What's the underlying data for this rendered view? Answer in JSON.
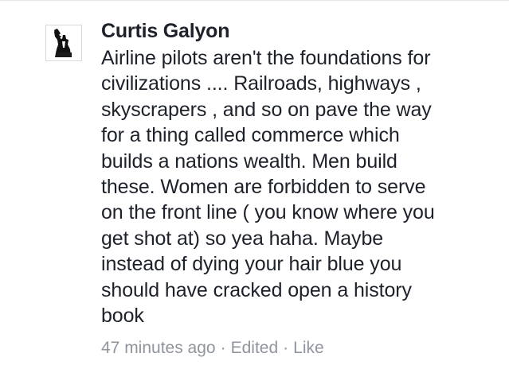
{
  "comment": {
    "author_name": "Curtis Galyon",
    "body_lines": [
      "Airline pilots aren't the foundations for",
      "civilizations .... Railroads, highways ,",
      "skyscrapers , and so on pave the way",
      "for a thing called commerce which",
      "builds a nations wealth. Men build",
      "these. Women are forbidden to serve",
      "on the front line ( you know where you",
      "get shot at) so yea haha. Maybe",
      "instead of dying your hair blue you",
      "should have cracked open a history",
      "book"
    ],
    "timestamp": "47 minutes ago",
    "separator": "·",
    "edited_label": "Edited",
    "like_label": "Like",
    "avatar_icon": "user-avatar-icon"
  },
  "colors": {
    "text": "#1d2129",
    "meta": "#90949c",
    "background": "#ffffff"
  }
}
